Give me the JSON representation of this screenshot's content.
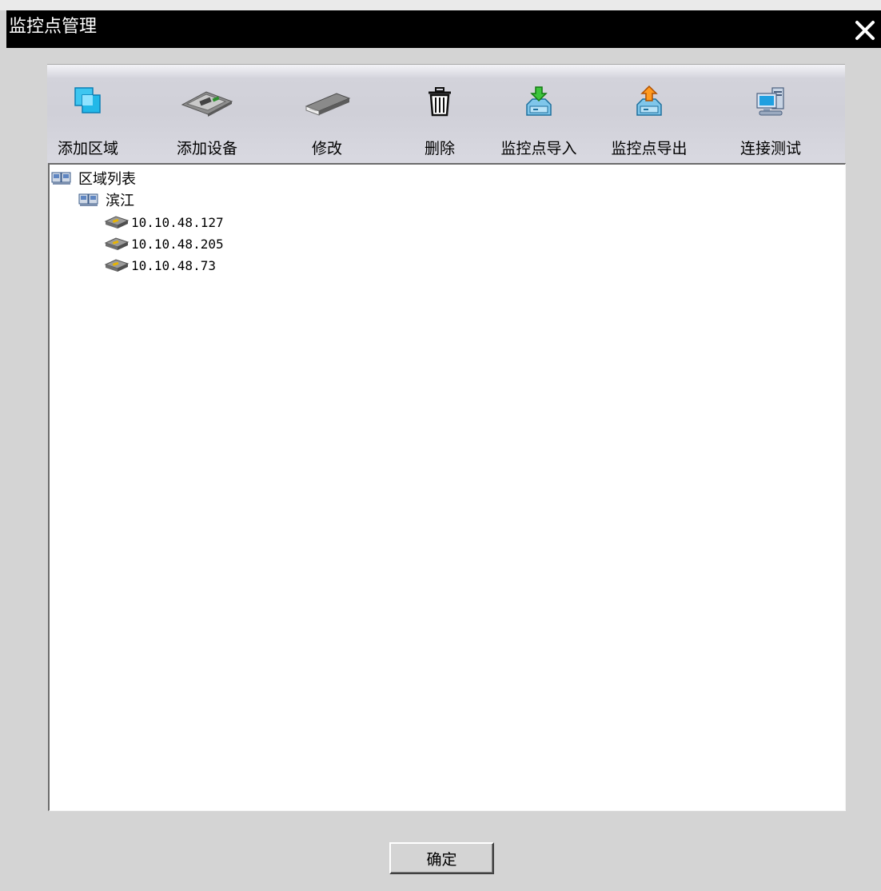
{
  "window": {
    "title": "监控点管理"
  },
  "toolbar": {
    "items": [
      {
        "label": "添加区域",
        "icon": "add-area-icon"
      },
      {
        "label": "添加设备",
        "icon": "add-device-icon"
      },
      {
        "label": "修改",
        "icon": "edit-icon"
      },
      {
        "label": "删除",
        "icon": "delete-icon"
      },
      {
        "label": "监控点导入",
        "icon": "import-icon"
      },
      {
        "label": "监控点导出",
        "icon": "export-icon"
      },
      {
        "label": "连接测试",
        "icon": "connection-test-icon"
      }
    ]
  },
  "tree": {
    "root": {
      "label": "区域列表",
      "icon": "folder-icon"
    },
    "area": {
      "label": "滨江",
      "icon": "folder-icon"
    },
    "devices": [
      {
        "label": "10.10.48.127",
        "icon": "device-icon"
      },
      {
        "label": "10.10.48.205",
        "icon": "device-icon"
      },
      {
        "label": "10.10.48.73",
        "icon": "device-icon"
      }
    ]
  },
  "footer": {
    "ok_label": "确定"
  },
  "colors": {
    "titlebar": "#000000",
    "background": "#d4d4d4",
    "tree_background": "#ffffff"
  }
}
